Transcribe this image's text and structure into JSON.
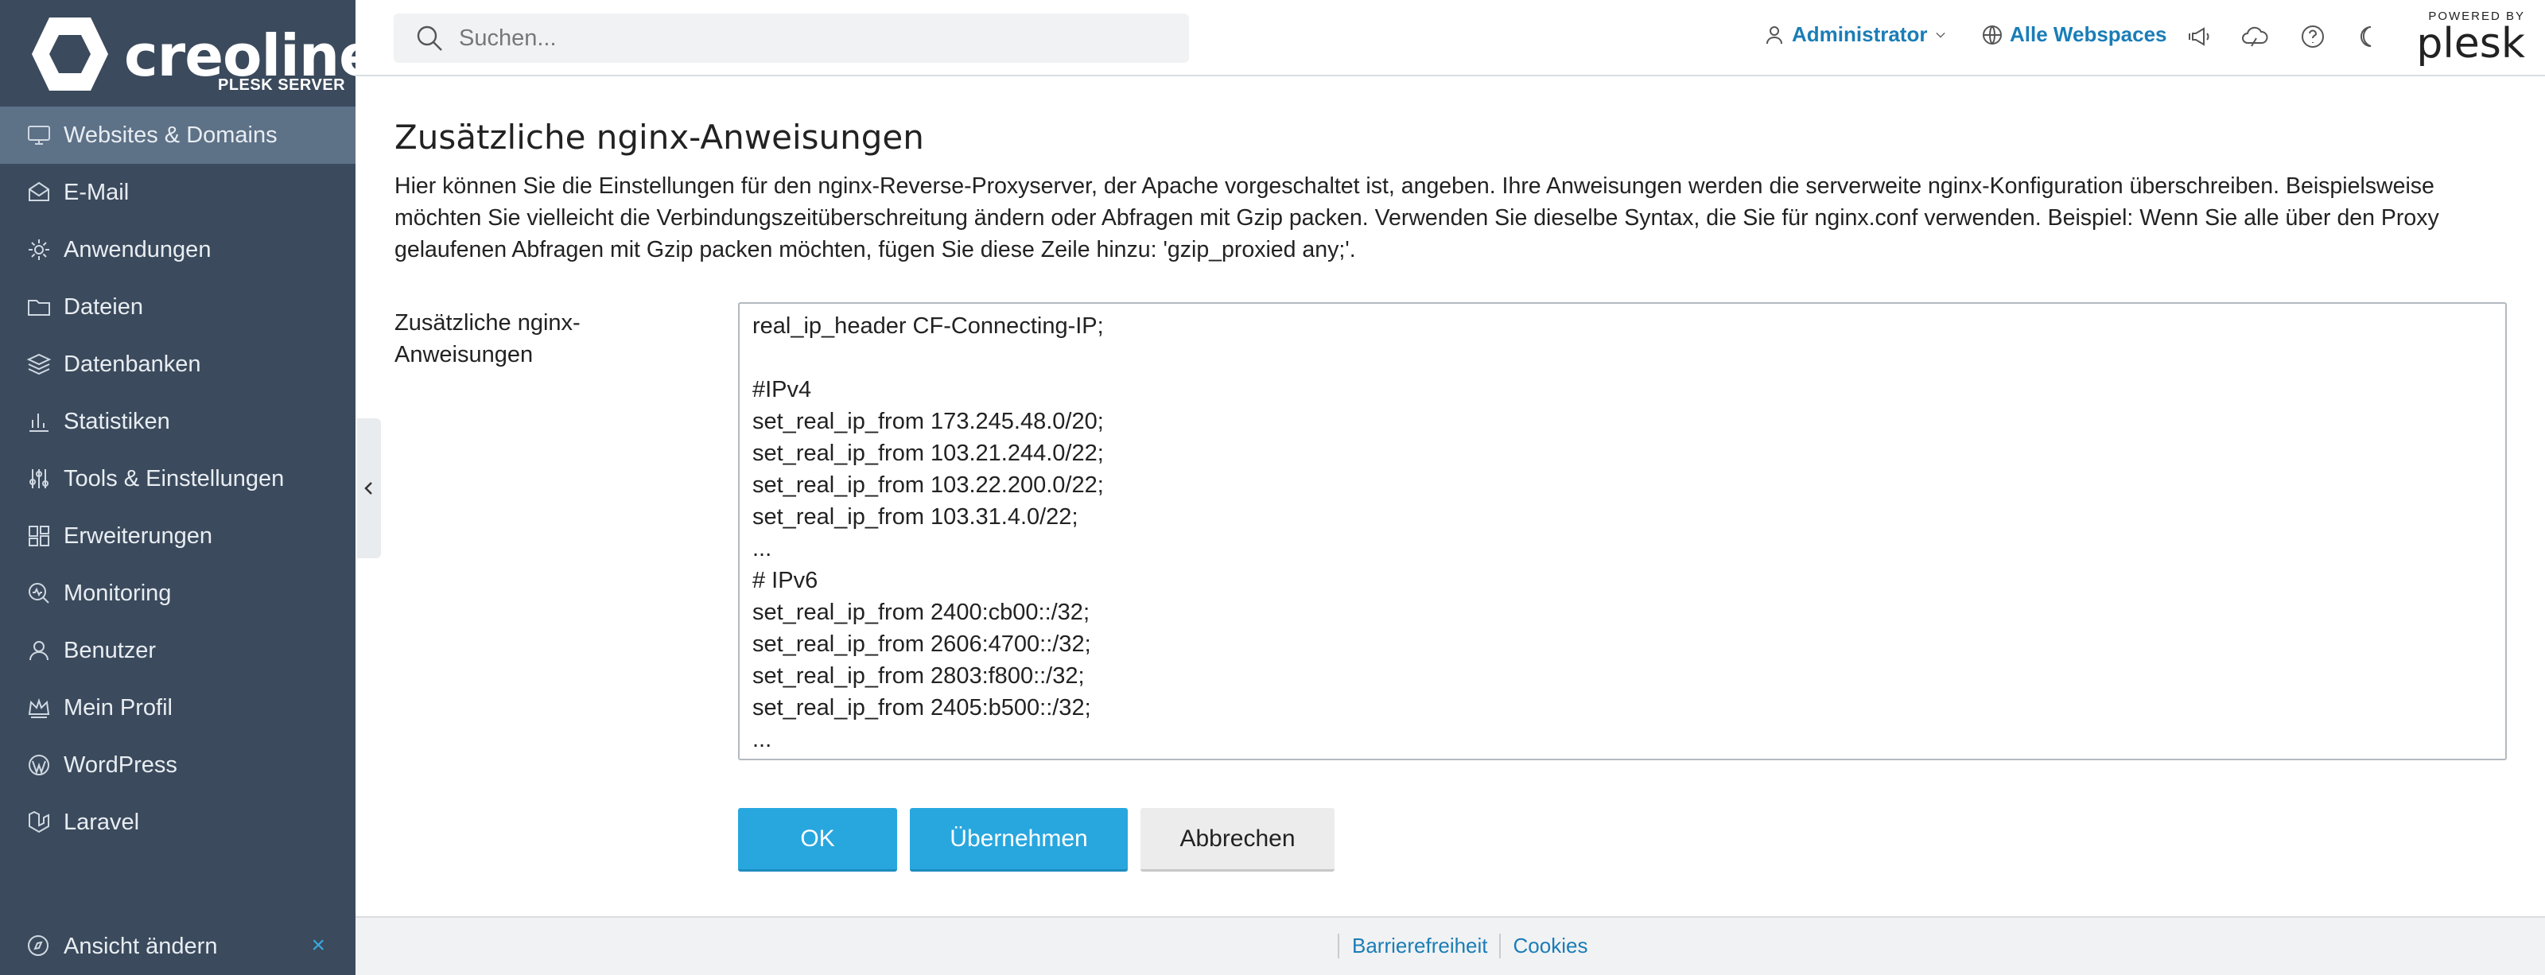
{
  "brand": {
    "name": "creoline",
    "subtitle": "PLESK SERVER"
  },
  "sidebar": {
    "items": [
      {
        "label": "Websites & Domains",
        "icon": "monitor-icon",
        "active": true
      },
      {
        "label": "E-Mail",
        "icon": "mail-icon",
        "active": false
      },
      {
        "label": "Anwendungen",
        "icon": "gear-icon",
        "active": false
      },
      {
        "label": "Dateien",
        "icon": "folder-icon",
        "active": false
      },
      {
        "label": "Datenbanken",
        "icon": "layers-icon",
        "active": false
      },
      {
        "label": "Statistiken",
        "icon": "bar-chart-icon",
        "active": false
      },
      {
        "label": "Tools & Einstellungen",
        "icon": "sliders-icon",
        "active": false
      },
      {
        "label": "Erweiterungen",
        "icon": "extensions-icon",
        "active": false
      },
      {
        "label": "Monitoring",
        "icon": "monitoring-icon",
        "active": false
      },
      {
        "label": "Benutzer",
        "icon": "user-icon",
        "active": false
      },
      {
        "label": "Mein Profil",
        "icon": "crown-icon",
        "active": false
      },
      {
        "label": "WordPress",
        "icon": "wordpress-icon",
        "active": false
      },
      {
        "label": "Laravel",
        "icon": "laravel-icon",
        "active": false
      }
    ],
    "footer_label": "Ansicht ändern",
    "footer_close": "×"
  },
  "header": {
    "search_placeholder": "Suchen...",
    "user_label": "Administrator",
    "webspaces_label": "Alle Webspaces",
    "powered_by": "POWERED BY",
    "powered_brand": "plesk"
  },
  "main": {
    "title": "Zusätzliche nginx-Anweisungen",
    "description": "Hier können Sie die Einstellungen für den nginx-Reverse-Proxyserver, der Apache vorgeschaltet ist, angeben. Ihre Anweisungen werden die serverweite nginx-Konfiguration überschreiben. Beispielsweise möchten Sie vielleicht die Verbindungszeitüberschreitung ändern oder Abfragen mit Gzip packen. Verwenden Sie dieselbe Syntax, die Sie für nginx.conf verwenden. Beispiel: Wenn Sie alle über den Proxy gelaufenen Abfragen mit Gzip packen möchten, fügen Sie diese Zeile hinzu: 'gzip_proxied any;'.",
    "field_label": "Zusätzliche nginx-Anweisungen",
    "textarea_lines": [
      "real_ip_header CF-Connecting-IP;",
      "",
      "#IPv4",
      "set_real_ip_from 173.245.48.0/20;",
      "set_real_ip_from 103.21.244.0/22;",
      "set_real_ip_from 103.22.200.0/22;",
      "set_real_ip_from 103.31.4.0/22;",
      "...",
      "# IPv6",
      "set_real_ip_from 2400:cb00::/32;",
      "set_real_ip_from 2606:4700::/32;",
      "set_real_ip_from 2803:f800::/32;",
      "set_real_ip_from 2405:b500::/32;",
      "..."
    ],
    "buttons": {
      "ok": "OK",
      "apply": "Übernehmen",
      "cancel": "Abbrechen"
    }
  },
  "footer": {
    "links": [
      "Barrierefreiheit",
      "Cookies"
    ]
  },
  "colors": {
    "sidebar_bg": "#3b4a5c",
    "sidebar_active": "#5d7187",
    "accent": "#28a7df",
    "link": "#1a7db7"
  }
}
